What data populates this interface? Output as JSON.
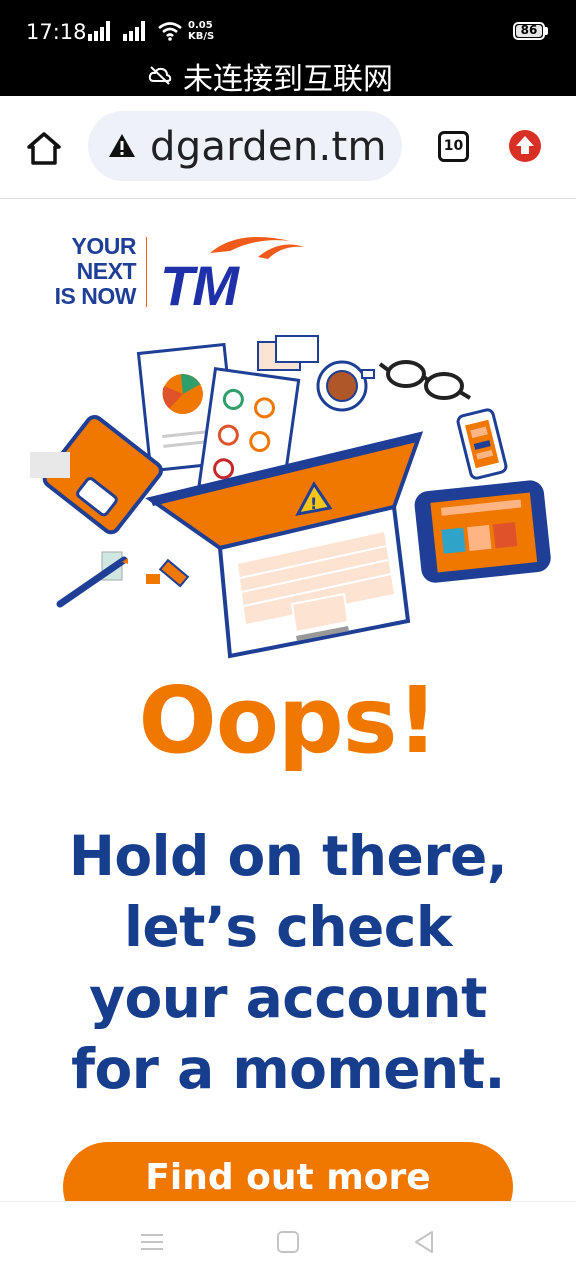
{
  "status_bar": {
    "time": "17:18",
    "net_speed_value": "0.05",
    "net_speed_unit": "KB/S",
    "battery": "86",
    "network_notice": "未连接到互联网",
    "icons": [
      "signal-icon",
      "signal-icon",
      "wifi-icon",
      "battery-icon",
      "cloud-off-icon"
    ]
  },
  "browser": {
    "url": "dgarden.tm",
    "tab_count": "10",
    "icons": [
      "home-icon",
      "warning-icon",
      "tabs-icon",
      "update-icon"
    ]
  },
  "brand": {
    "tagline_line1": "YOUR",
    "tagline_line2": "NEXT",
    "tagline_line3": "IS NOW",
    "logo_text": "TM"
  },
  "page": {
    "headline": "Oops!",
    "message": "Hold on there, let’s check your account for a moment.",
    "cta_label": "Find out more"
  },
  "colors": {
    "accent_orange": "#f07700",
    "brand_blue": "#163e8c",
    "logo_blue": "#1f31a8",
    "status_bar_bg": "#000000",
    "url_bar_bg": "#eef1f8",
    "update_red": "#d93025"
  },
  "nav_bar": {
    "icons": [
      "menu-icon",
      "home-square-icon",
      "back-icon"
    ]
  }
}
